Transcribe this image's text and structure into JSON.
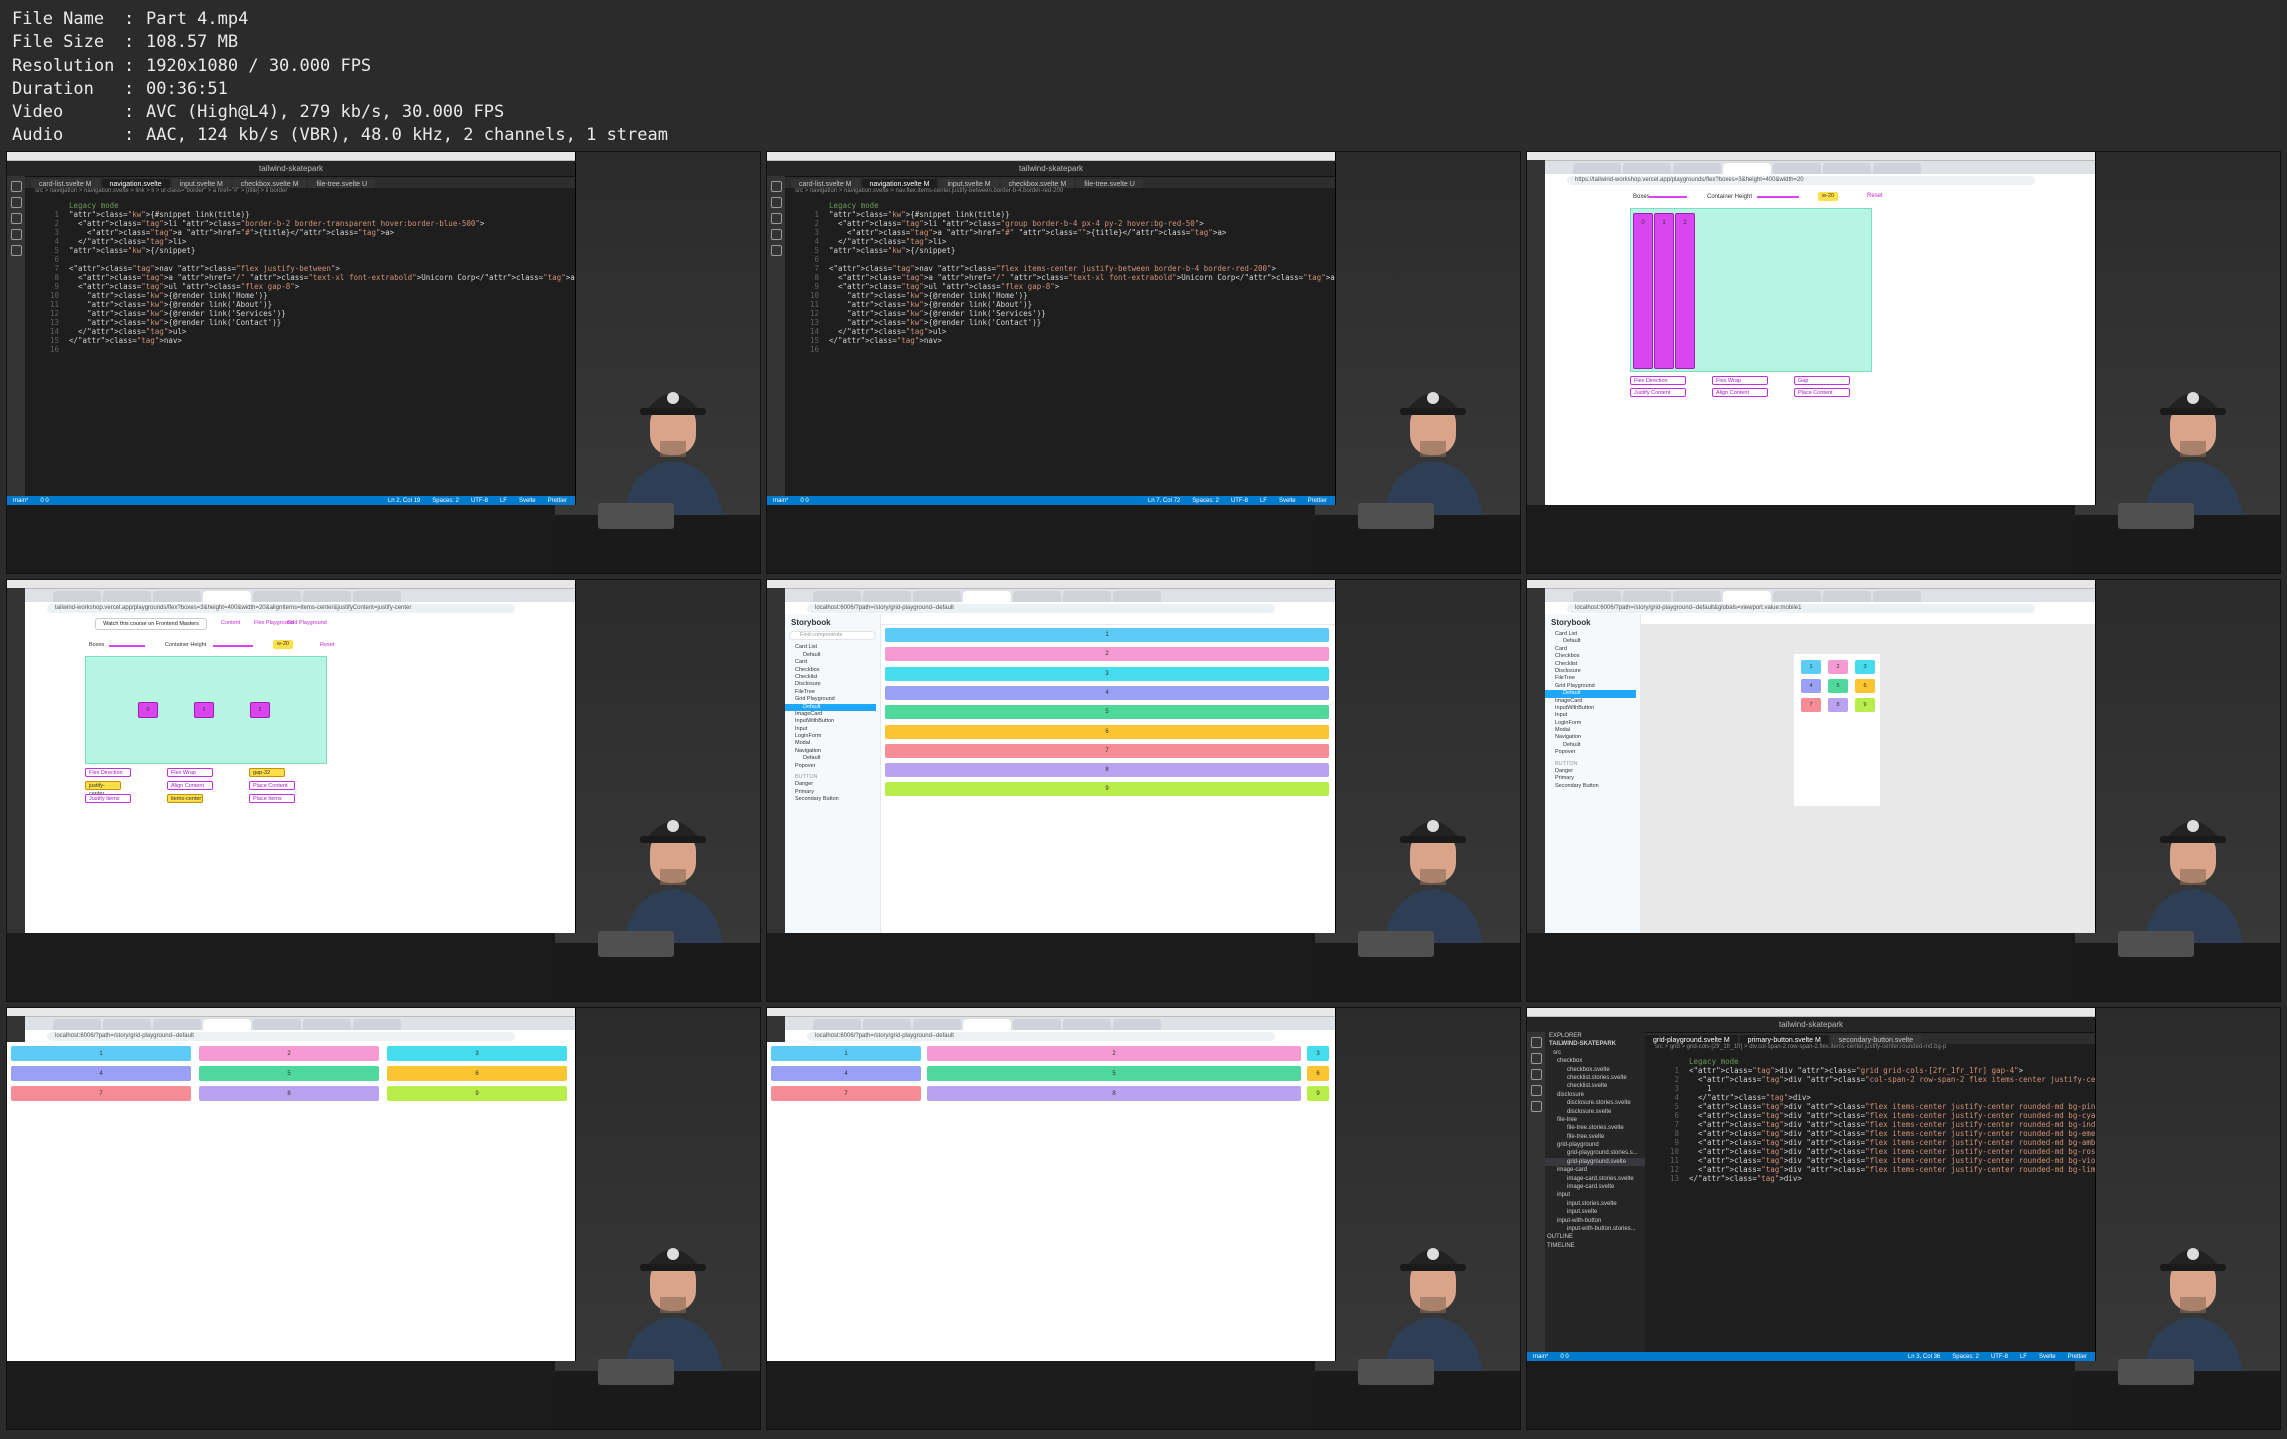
{
  "file_info": [
    {
      "key": "File Name",
      "value": "Part 4.mp4"
    },
    {
      "key": "File Size",
      "value": "108.57 MB"
    },
    {
      "key": "Resolution",
      "value": "1920x1080 / 30.000 FPS"
    },
    {
      "key": "Duration",
      "value": "00:36:51"
    },
    {
      "key": "Video",
      "value": "AVC (High@L4), 279 kb/s, 30.000 FPS"
    },
    {
      "key": "Audio",
      "value": "AAC, 124 kb/s (VBR), 48.0 kHz, 2 channels, 1 stream"
    }
  ],
  "vscode1": {
    "title": "tailwind-skatepark",
    "tabs": [
      "card-list.svelte M",
      "navigation.svelte",
      "input.svelte M",
      "checkbox.svelte M",
      "file-tree.svelte U"
    ],
    "breadcrumb": "src > navigation > navigation.svelte > link > li > ul class=\"border\" > a href=\"#\" > [title] > li border",
    "legacy": "Legacy mode",
    "lines": [
      "{#snippet link(title)}",
      "  <li class=\"border-b-2 border-transparent hover:border-blue-500\">",
      "    <a href=\"#\">{title}</a>",
      "  </li>",
      "{/snippet}",
      "",
      "<nav class=\"flex justify-between\">",
      "  <a href=\"/\" class=\"text-xl font-extrabold\">Unicorn Corp</a>",
      "  <ul class=\"flex gap-8\">",
      "    {@render link('Home')}",
      "    {@render link('About')}",
      "    {@render link('Services')}",
      "    {@render link('Contact')}",
      "  </ul>",
      "</nav>",
      ""
    ],
    "status": [
      "main*",
      "0 0",
      "Ln 2, Col 19",
      "Spaces: 2",
      "UTF-8",
      "LF",
      "Svelte",
      "Prettier"
    ]
  },
  "vscode2": {
    "title": "tailwind-skatepark",
    "tabs": [
      "card-list.svelte M",
      "navigation.svelte M",
      "input.svelte M",
      "checkbox.svelte M",
      "file-tree.svelte U"
    ],
    "breadcrumb": "src > navigation > navigation.svelte > nav.flex.items-center.justify-between.border-b-4.border-red-200",
    "legacy": "Legacy mode",
    "lines": [
      "{#snippet link(title)}",
      "  <li class=\"group border-b-4 px-4 py-2 hover:bg-red-50\">",
      "    <a href=\"#\" class=\"\">{title}</a>",
      "  </li>",
      "{/snippet}",
      "",
      "<nav class=\"flex items-center justify-between border-b-4 border-red-200\">",
      "  <a href=\"/\" class=\"text-xl font-extrabold\">Unicorn Corp</a>",
      "  <ul class=\"flex gap-8\">",
      "    {@render link('Home')}",
      "    {@render link('About')}",
      "    {@render link('Services')}",
      "    {@render link('Contact')}",
      "  </ul>",
      "</nav>",
      ""
    ],
    "status": [
      "main*",
      "0 0",
      "Ln 7, Col 72",
      "Spaces: 2",
      "UTF-8",
      "LF",
      "Svelte",
      "Prettier"
    ]
  },
  "flex1": {
    "url": "https://tailwind-workshop.vercel.app/playgrounds/flex?boxes=3&height=400&width=20",
    "boxes_label": "Boxes",
    "container_label": "Container Height",
    "gap_value": "w-20",
    "reset": "Reset",
    "box_labels": [
      "0",
      "1",
      "2"
    ],
    "pills": [
      "Flex Direction",
      "Flex Wrap",
      "Gap",
      "Justify Content",
      "Align Content",
      "Place Content"
    ]
  },
  "flex2": {
    "url": "tailwind-workshop.vercel.app/playgrounds/flex?boxes=3&height=400&width=20&alignItems=items-center&justifyContent=justify-center",
    "banner": "Watch this course on Frontend Masters",
    "nav": [
      "Content",
      "Flex Playground",
      "Grid Playground"
    ],
    "boxes_label": "Boxes",
    "container_label": "Container Height",
    "gap_value": "w-20",
    "reset": "Reset",
    "box_labels": [
      "0",
      "1",
      "2"
    ],
    "pills": [
      {
        "label": "Flex Direction",
        "yellow": false
      },
      {
        "label": "Flex Wrap",
        "yellow": false
      },
      {
        "label": "gap-32",
        "yellow": true
      },
      {
        "label": "justify-center",
        "yellow": true
      },
      {
        "label": "Align Content",
        "yellow": false
      },
      {
        "label": "Place Content",
        "yellow": false
      },
      {
        "label": "Justify Items",
        "yellow": false
      },
      {
        "label": "items-center",
        "yellow": true
      },
      {
        "label": "Place Items",
        "yellow": false
      }
    ]
  },
  "storybook1": {
    "url": "localhost:6006/?path=/story/grid-playground--default",
    "logo": "Storybook",
    "search": "Find components",
    "items": [
      "Card List",
      "Default",
      "Card",
      "Checkbox",
      "Checklist",
      "Disclosure",
      "FileTree",
      "Grid Playground",
      "Default",
      "ImageCard",
      "InputWithButton",
      "Input",
      "LoginForm",
      "Modal",
      "Navigation",
      "Default",
      "Popover",
      "BUTTON",
      "Danger",
      "Primary",
      "Secondary Button"
    ],
    "selected_index": 8,
    "bars": [
      "1",
      "2",
      "3",
      "4",
      "5",
      "6",
      "7",
      "8",
      "9"
    ]
  },
  "storybook2": {
    "url": "localhost:6006/?path=/story/grid-playground--default&globals=viewport.value:mobile1",
    "logo": "Storybook",
    "cells": [
      "1",
      "2",
      "3",
      "4",
      "5",
      "6",
      "7",
      "8",
      "9"
    ]
  },
  "grid3": {
    "url": "localhost:6006/?path=/story/grid-playground--default",
    "cells": [
      "1",
      "2",
      "3",
      "4",
      "5",
      "6",
      "7",
      "8",
      "9"
    ]
  },
  "grid4": {
    "url": "localhost:6006/?path=/story/grid-playground--default",
    "cells": [
      "1",
      "2",
      "3",
      "4",
      "5",
      "6",
      "7",
      "8",
      "9"
    ]
  },
  "vscode3": {
    "title": "tailwind-skatepark",
    "tabs": [
      "grid-playground.svelte M",
      "primary-button.svelte M",
      "secondary-button.svelte"
    ],
    "explorer_title": "EXPLORER",
    "project": "TAILWIND-SKATEPARK",
    "tree": [
      "src",
      "checkbox",
      "checkbox.svelte",
      "checklist.stories.svelte",
      "checklist.svelte",
      "disclosure",
      "disclosure.stories.svelte",
      "disclosure.svelte",
      "file-tree",
      "file-tree.stories.svelte",
      "file-tree.svelte",
      "grid-playground",
      "grid-playground.stories.s...",
      "grid-playground.svelte",
      "image-card",
      "image-card.stories.svelte",
      "image-card.svelte",
      "input",
      "input.stories.svelte",
      "input.svelte",
      "input-with-button",
      "input-with-button.stories...",
      "OUTLINE",
      "TIMELINE"
    ],
    "breadcrumb": "src > grid > grid-cols-[2fr_1fr_1fr] > div.col-span-2.row-span-2.flex.items-center.justify-center.rounded-md.bg-p",
    "legacy": "Legacy mode",
    "lines": [
      "<div class=\"grid grid-cols-[2fr_1fr_1fr] gap-4\">",
      "  <div class=\"col-span-2 row-span-2 flex items-center justify-center",
      "    1",
      "  </div>",
      "  <div class=\"flex items-center justify-center rounded-md bg-pink-",
      "  <div class=\"flex items-center justify-center rounded-md bg-cyan-",
      "  <div class=\"flex items-center justify-center rounded-md bg-indig",
      "  <div class=\"flex items-center justify-center rounded-md bg-emera",
      "  <div class=\"flex items-center justify-center rounded-md bg-amber",
      "  <div class=\"flex items-center justify-center rounded-md bg-rose-",
      "  <div class=\"flex items-center justify-center rounded-md bg-viole",
      "  <div class=\"flex items-center justify-center rounded-md bg-lime-",
      "</div>"
    ],
    "status": [
      "main*",
      "0 0",
      "Ln 3, Col 36",
      "Spaces: 2",
      "UTF-8",
      "LF",
      "Svelte",
      "Prettier"
    ]
  },
  "colors": {
    "c1": "#5ccbf5",
    "c2": "#f59ad2",
    "c3": "#45dcee",
    "c4": "#9aa0f5",
    "c5": "#4fd89b",
    "c6": "#fbc531",
    "c7": "#f58c96",
    "c8": "#b9a2ef",
    "c9": "#b8ed4a",
    "magenta": "#d946ef",
    "mint": "#b7f5e3",
    "vscode_blue": "#007acc"
  }
}
